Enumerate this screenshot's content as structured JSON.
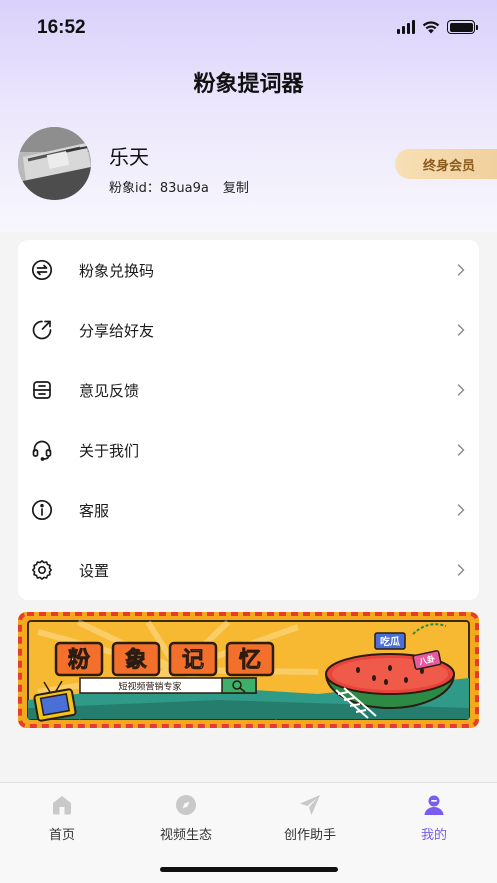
{
  "status_bar": {
    "time": "16:52"
  },
  "header": {
    "title": "粉象提词器"
  },
  "profile": {
    "name": "乐天",
    "id_text": "粉象id：83ua9a",
    "copy_label": "复制",
    "member_badge": "终身会员"
  },
  "menu": {
    "items": [
      {
        "label": "粉象兑换码",
        "icon": "exchange-icon"
      },
      {
        "label": "分享给好友",
        "icon": "share-icon"
      },
      {
        "label": "意见反馈",
        "icon": "feedback-icon"
      },
      {
        "label": "关于我们",
        "icon": "headset-icon"
      },
      {
        "label": "客服",
        "icon": "info-icon"
      },
      {
        "label": "设置",
        "icon": "gear-icon"
      }
    ]
  },
  "banner": {
    "title_chars": [
      "粉",
      "象",
      "记",
      "忆"
    ],
    "search_text": "短视频营销专家",
    "tag_1": "吃瓜",
    "tag_2": "八卦"
  },
  "colors": {
    "accent": "#7a5cf0",
    "member_gold": "#f1d09d",
    "banner_orange": "#f4a81d",
    "banner_red": "#e83b2f"
  },
  "tab_bar": {
    "tabs": [
      {
        "label": "首页",
        "icon": "home-icon"
      },
      {
        "label": "视频生态",
        "icon": "compass-icon"
      },
      {
        "label": "创作助手",
        "icon": "paper-plane-icon"
      },
      {
        "label": "我的",
        "icon": "user-icon",
        "active": true
      }
    ]
  }
}
